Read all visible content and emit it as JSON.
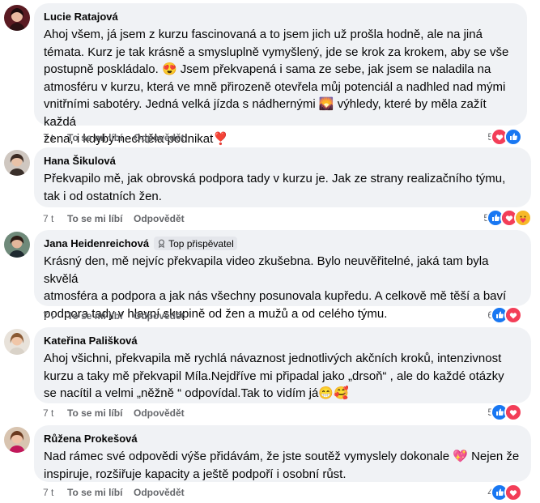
{
  "comments": [
    {
      "author": "Lucie Ratajová",
      "text_html_parts": [
        "Ahoj všem, já jsem z kurzu fascinovaná a to jsem jich už prošla hodně, ale na jiná",
        "témata. Kurz je tak krásně a smysluplně vymyšlený, jde se krok za krokem, aby se vše",
        "postupně poskládalo. 😍 Jsem překvapená i sama ze sebe, jak jsem se naladila na",
        "atmosféru v kurzu, která ve mně přirozeně otevřela můj potenciál a nadhled nad mými",
        "vnitřními sabotéry. Jedná velká jízda s nádhernými 🌄 výhledy, které by měla zažít každá",
        "žena, i kdyby nechtěla podnikat❣️"
      ],
      "time": "7 t",
      "like": "To se mi líbí",
      "reply": "Odpovědět",
      "reaction_count": "5",
      "reactions": [
        "love",
        "like"
      ]
    },
    {
      "author": "Hana Šikulová",
      "text_html_parts": [
        "Překvapilo mě, jak obrovská podpora tady v kurzu je. Jak ze strany realizačního týmu,",
        "tak i od ostatních žen."
      ],
      "time": "7 t",
      "like": "To se mi líbí",
      "reply": "Odpovědět",
      "reaction_count": "5",
      "reactions": [
        "like",
        "love",
        "care"
      ]
    },
    {
      "author": "Jana Heidenreichová",
      "badge": "Top přispěvatel",
      "text_html_parts": [
        "Krásný den, mě nejvíc překvapila video zkušebna. Bylo neuvěřitelné, jaká tam byla skvělá",
        "atmosféra a podpora a jak nás všechny posunovala kupředu. A celkově mě těší a baví",
        "podpora tady v hlavní skupině od žen a mužů a od celého týmu."
      ],
      "time": "7 t",
      "like": "To se mi líbí",
      "reply": "Odpovědět",
      "reaction_count": "6",
      "reactions": [
        "like",
        "love"
      ]
    },
    {
      "author": "Kateřina Pališková",
      "text_html_parts": [
        "Ahoj všichni, překvapila mě rychlá návaznost jednotlivých akčních kroků, intenzivnost",
        "kurzu a taky mě překvapil Míla.Nejdříve mi připadal jako „drsoň“ , ale do každé otázky",
        "se nacítil a velmi „něžně “ odpovídal.Tak to vidím já😁🥰"
      ],
      "time": "7 t",
      "like": "To se mi líbí",
      "reply": "Odpovědět",
      "reaction_count": "5",
      "reactions": [
        "like",
        "love"
      ]
    },
    {
      "author": "Růžena Prokešová",
      "text_html_parts": [
        "Nad rámec své odpovědi výše přidávám, že jste soutěž vymyslely dokonale 💖 Nejen že",
        "inspiruje, rozšiřuje kapacity a ještě podpoří i osobní růst."
      ],
      "time": "7 t",
      "like": "To se mi líbí",
      "reply": "Odpovědět",
      "reaction_count": "4",
      "reactions": [
        "like",
        "love"
      ]
    }
  ],
  "colors": {
    "bubble": "#f0f2f5",
    "like_blue": "#1877f2",
    "love_red": "#f33e58",
    "care_yellow": "#f7b928",
    "meta_gray": "#65676b"
  }
}
